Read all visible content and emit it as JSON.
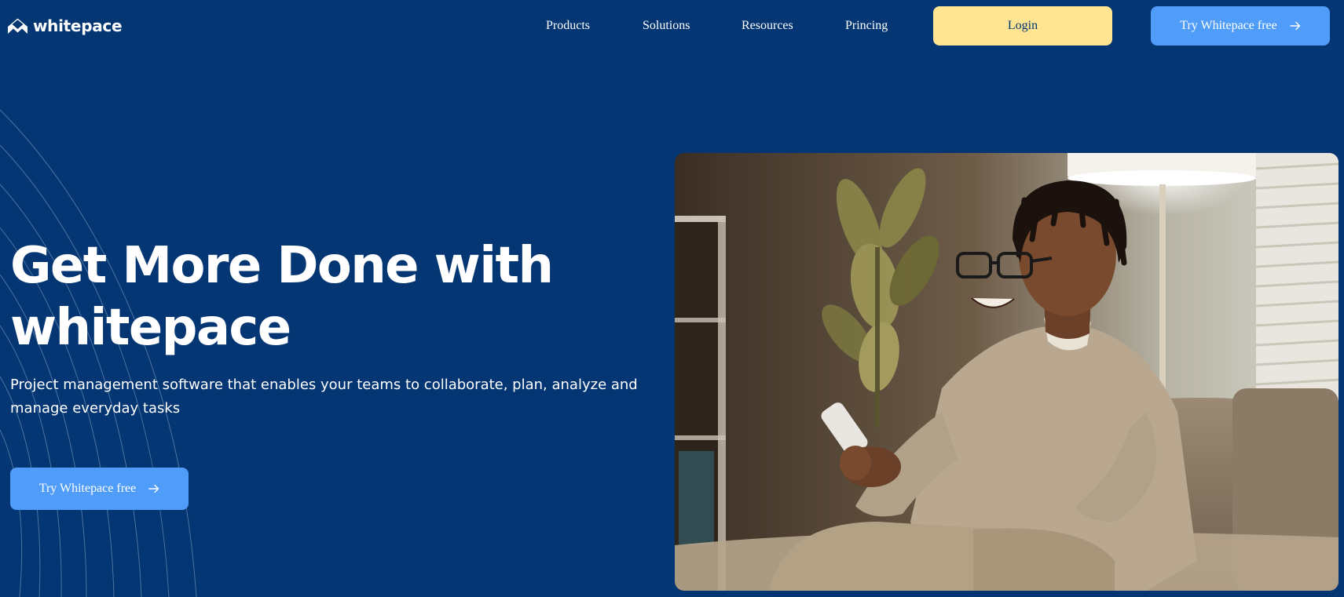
{
  "brand": {
    "name": "whitepace",
    "logo_icon": "whitepace-logo-icon"
  },
  "nav": {
    "items": [
      {
        "label": "Products"
      },
      {
        "label": "Solutions"
      },
      {
        "label": "Resources"
      },
      {
        "label": "Princing"
      }
    ],
    "login_label": "Login",
    "try_label": "Try Whitepace free"
  },
  "hero": {
    "title_line1": "Get More Done with",
    "title_line2": "whitepace",
    "subtitle": "Project management software that enables your teams to collaborate, plan, analyze and manage everyday tasks",
    "cta_label": "Try Whitepace free",
    "image_icon": "smiling-man-with-phone-photo"
  },
  "colors": {
    "background": "#043673",
    "login_button": "#ffe492",
    "primary_button": "#4f9cf9",
    "text": "#ffffff"
  }
}
